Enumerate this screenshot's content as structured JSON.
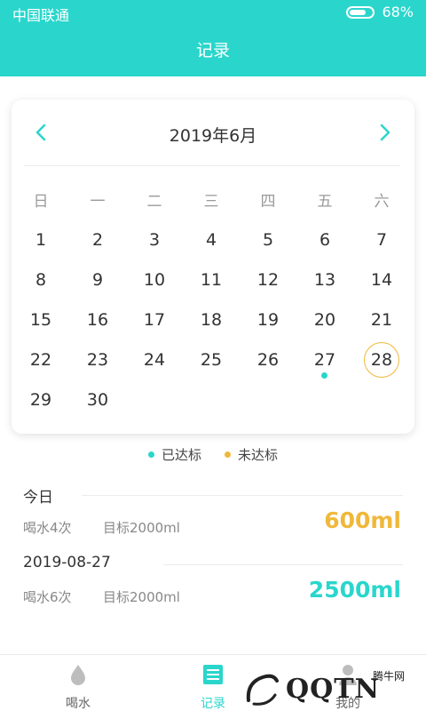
{
  "status_bar": {
    "carrier": "中国联通",
    "battery": "68%"
  },
  "header": {
    "title": "记录"
  },
  "calendar": {
    "month_title": "2019年6月",
    "weekdays": [
      "日",
      "一",
      "二",
      "三",
      "四",
      "五",
      "六"
    ],
    "rows": [
      [
        "1",
        "2",
        "3",
        "4",
        "5",
        "6",
        "7"
      ],
      [
        "8",
        "9",
        "10",
        "11",
        "12",
        "13",
        "14"
      ],
      [
        "15",
        "16",
        "17",
        "18",
        "19",
        "20",
        "21"
      ],
      [
        "22",
        "23",
        "24",
        "25",
        "26",
        "27",
        "28"
      ],
      [
        "29",
        "30",
        "",
        "",
        "",
        "",
        ""
      ]
    ],
    "reached_days": [
      "27"
    ],
    "selected_day": "28"
  },
  "legend": {
    "reached": "已达标",
    "not_reached": "未达标"
  },
  "records": [
    {
      "title": "今日",
      "count": "喝水4次",
      "target": "目标2000ml",
      "amount": "600ml",
      "status": "not_reached"
    },
    {
      "title": "2019-08-27",
      "count": "喝水6次",
      "target": "目标2000ml",
      "amount": "2500ml",
      "status": "reached"
    }
  ],
  "tabs": [
    {
      "label": "喝水",
      "icon": "water-drop-icon",
      "active": false
    },
    {
      "label": "记录",
      "icon": "record-list-icon",
      "active": true
    },
    {
      "label": "我的",
      "icon": "person-icon",
      "active": false
    }
  ],
  "watermark": {
    "logo_text": "QQTN",
    "small_text": "腾牛网"
  },
  "colors": {
    "accent": "#2ad6cc",
    "reached": "#2ad6cc",
    "not_reached": "#f0b83a",
    "text": "#333333",
    "muted": "#888888"
  }
}
